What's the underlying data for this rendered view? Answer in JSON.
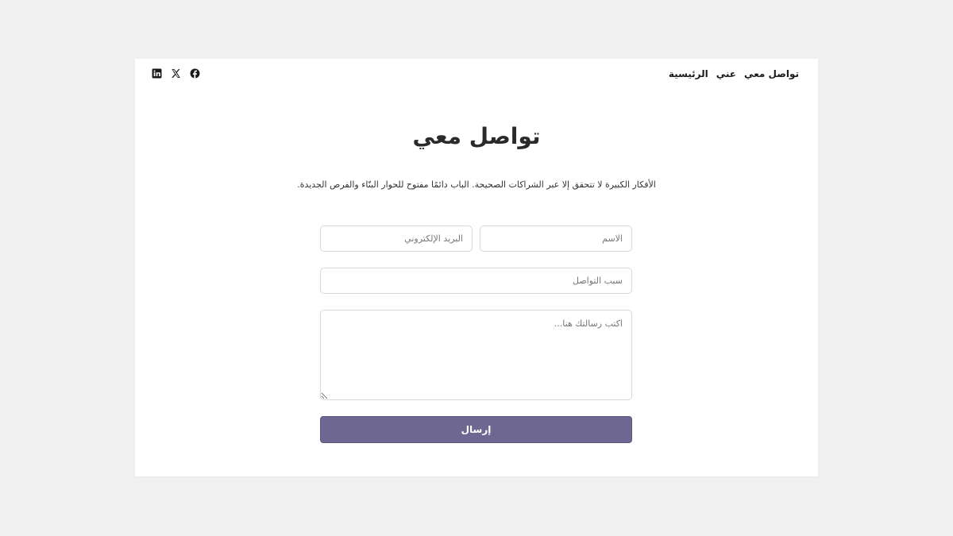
{
  "nav": {
    "items": [
      {
        "label": "الرئيسية"
      },
      {
        "label": "عني"
      },
      {
        "label": "تواصل معي"
      }
    ]
  },
  "social": [
    {
      "icon": "facebook-icon"
    },
    {
      "icon": "x-icon"
    },
    {
      "icon": "linkedin-icon"
    }
  ],
  "header": {
    "title": "تواصل معي",
    "subtitle": "الأفكار الكبيرة لا تتحقق إلا عبر الشراكات الصحيحة. الباب دائمًا مفتوح للحوار البنّاء والفرص الجديدة."
  },
  "form": {
    "name_placeholder": "الاسم",
    "email_placeholder": "البريد الإلكتروني",
    "reason_placeholder": "سبب التواصل",
    "message_placeholder": "اكتب رسالتك هنا...",
    "submit_label": "إرسال"
  },
  "colors": {
    "background": "#f0f0f0",
    "card": "#ffffff",
    "button": "#6e6791",
    "text": "#222222"
  }
}
